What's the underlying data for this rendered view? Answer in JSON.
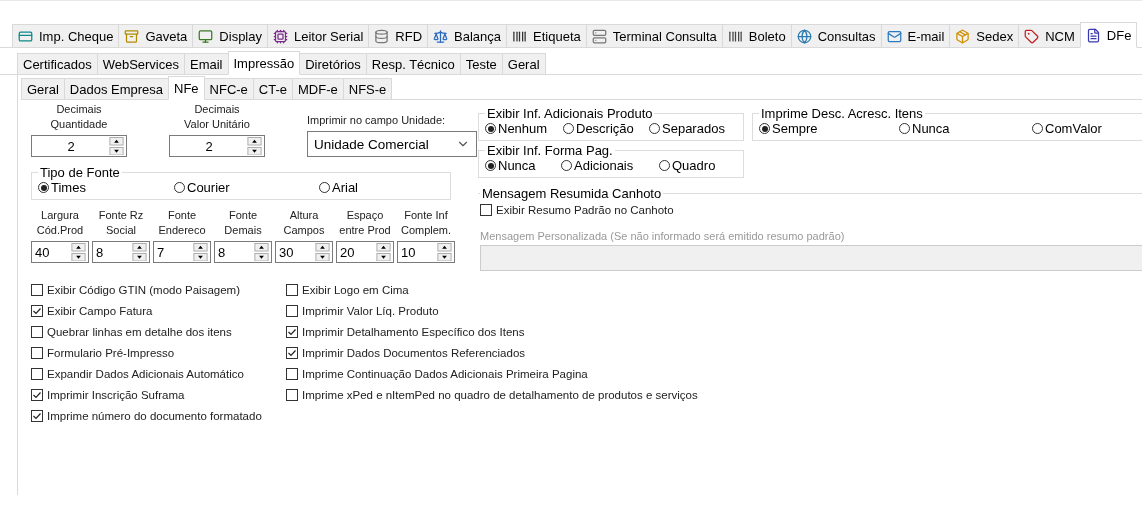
{
  "main_tabs": [
    {
      "label": "Imp. Cheque",
      "selected": false
    },
    {
      "label": "Gaveta",
      "selected": false
    },
    {
      "label": "Display",
      "selected": false
    },
    {
      "label": "Leitor Serial",
      "selected": false
    },
    {
      "label": "RFD",
      "selected": false
    },
    {
      "label": "Balança",
      "selected": false
    },
    {
      "label": "Etiqueta",
      "selected": false
    },
    {
      "label": "Terminal Consulta",
      "selected": false
    },
    {
      "label": "Boleto",
      "selected": false
    },
    {
      "label": "Consultas",
      "selected": false
    },
    {
      "label": "E-mail",
      "selected": false
    },
    {
      "label": "Sedex",
      "selected": false
    },
    {
      "label": "NCM",
      "selected": false
    },
    {
      "label": "DFe",
      "selected": true
    }
  ],
  "dfe_tabs": [
    {
      "label": "Certificados",
      "selected": false
    },
    {
      "label": "WebServices",
      "selected": false
    },
    {
      "label": "Email",
      "selected": false
    },
    {
      "label": "Impressão",
      "selected": true
    },
    {
      "label": "Diretórios",
      "selected": false
    },
    {
      "label": "Resp. Técnico",
      "selected": false
    },
    {
      "label": "Teste",
      "selected": false
    },
    {
      "label": "Geral",
      "selected": false
    }
  ],
  "print_tabs": [
    {
      "label": "Geral",
      "selected": false
    },
    {
      "label": "Dados Empresa",
      "selected": false
    },
    {
      "label": "NFe",
      "selected": true
    },
    {
      "label": "NFC-e",
      "selected": false
    },
    {
      "label": "CT-e",
      "selected": false
    },
    {
      "label": "MDF-e",
      "selected": false
    },
    {
      "label": "NFS-e",
      "selected": false
    }
  ],
  "decimals": [
    {
      "label_lines": [
        "Decimais",
        "Quantidade"
      ],
      "value": "2"
    },
    {
      "label_lines": [
        "Decimais",
        "Valor Unitário"
      ],
      "value": "2"
    }
  ],
  "unit_field": {
    "label": "Imprimir no campo Unidade:",
    "value": "Unidade Comercial"
  },
  "font_type": {
    "title": "Tipo de Fonte",
    "options": [
      {
        "label": "Times",
        "selected": true
      },
      {
        "label": "Courier",
        "selected": false
      },
      {
        "label": "Arial",
        "selected": false
      }
    ]
  },
  "layout_fields": [
    {
      "label_lines": [
        "Largura",
        "Cód.Prod"
      ],
      "value": "40"
    },
    {
      "label_lines": [
        "Fonte Rz",
        "Social"
      ],
      "value": "8"
    },
    {
      "label_lines": [
        "Fonte",
        "Endereco"
      ],
      "value": "7"
    },
    {
      "label_lines": [
        "Fonte",
        "Demais"
      ],
      "value": "8"
    },
    {
      "label_lines": [
        "Altura",
        "Campos"
      ],
      "value": "30"
    },
    {
      "label_lines": [
        "Espaço",
        "entre Prod"
      ],
      "value": "20"
    },
    {
      "label_lines": [
        "Fonte Inf",
        "Complem."
      ],
      "value": "10"
    }
  ],
  "checkboxes_left": [
    {
      "label": "Exibir Código GTIN (modo Paisagem)",
      "checked": false
    },
    {
      "label": "Exibir Campo Fatura",
      "checked": true
    },
    {
      "label": "Quebrar linhas em detalhe dos itens",
      "checked": false
    },
    {
      "label": "Formulario Pré-Impresso",
      "checked": false
    },
    {
      "label": "Expandir Dados Adicionais Automático",
      "checked": false
    },
    {
      "label": "Imprimir Inscrição Suframa",
      "checked": true
    },
    {
      "label": "Imprime número do documento formatado",
      "checked": true
    }
  ],
  "checkboxes_right": [
    {
      "label": "Exibir Logo em Cima",
      "checked": false
    },
    {
      "label": "Imprimir Valor Líq. Produto",
      "checked": false
    },
    {
      "label": "Imprimir Detalhamento Específico dos Itens",
      "checked": true
    },
    {
      "label": "Imprimir Dados Documentos Referenciados",
      "checked": true
    },
    {
      "label": "Imprime Continuação Dados Adicionais Primeira Pagina",
      "checked": false
    },
    {
      "label": "Imprime xPed e nItemPed no quadro de detalhamento de produtos e serviços",
      "checked": false
    }
  ],
  "product_info": {
    "title": "Exibir Inf. Adicionais Produto",
    "options": [
      {
        "label": "Nenhum",
        "selected": true
      },
      {
        "label": "Descrição",
        "selected": false
      },
      {
        "label": "Separados",
        "selected": false
      }
    ]
  },
  "item_discount": {
    "title": "Imprime Desc. Acresc. Itens",
    "options": [
      {
        "label": "Sempre",
        "selected": true
      },
      {
        "label": "Nunca",
        "selected": false
      },
      {
        "label": "ComValor",
        "selected": false
      }
    ]
  },
  "payment_info": {
    "title": "Exibir Inf. Forma Pag.",
    "options": [
      {
        "label": "Nunca",
        "selected": true
      },
      {
        "label": "Adicionais",
        "selected": false
      },
      {
        "label": "Quadro",
        "selected": false
      }
    ]
  },
  "stub_message": {
    "title": "Mensagem Resumida Canhoto",
    "checkbox": {
      "label": "Exibir Resumo Padrão no Canhoto",
      "checked": false
    },
    "field_label": "Mensagem Personalizada  (Se não informado será emitido resumo padrão)",
    "disabled": true
  }
}
